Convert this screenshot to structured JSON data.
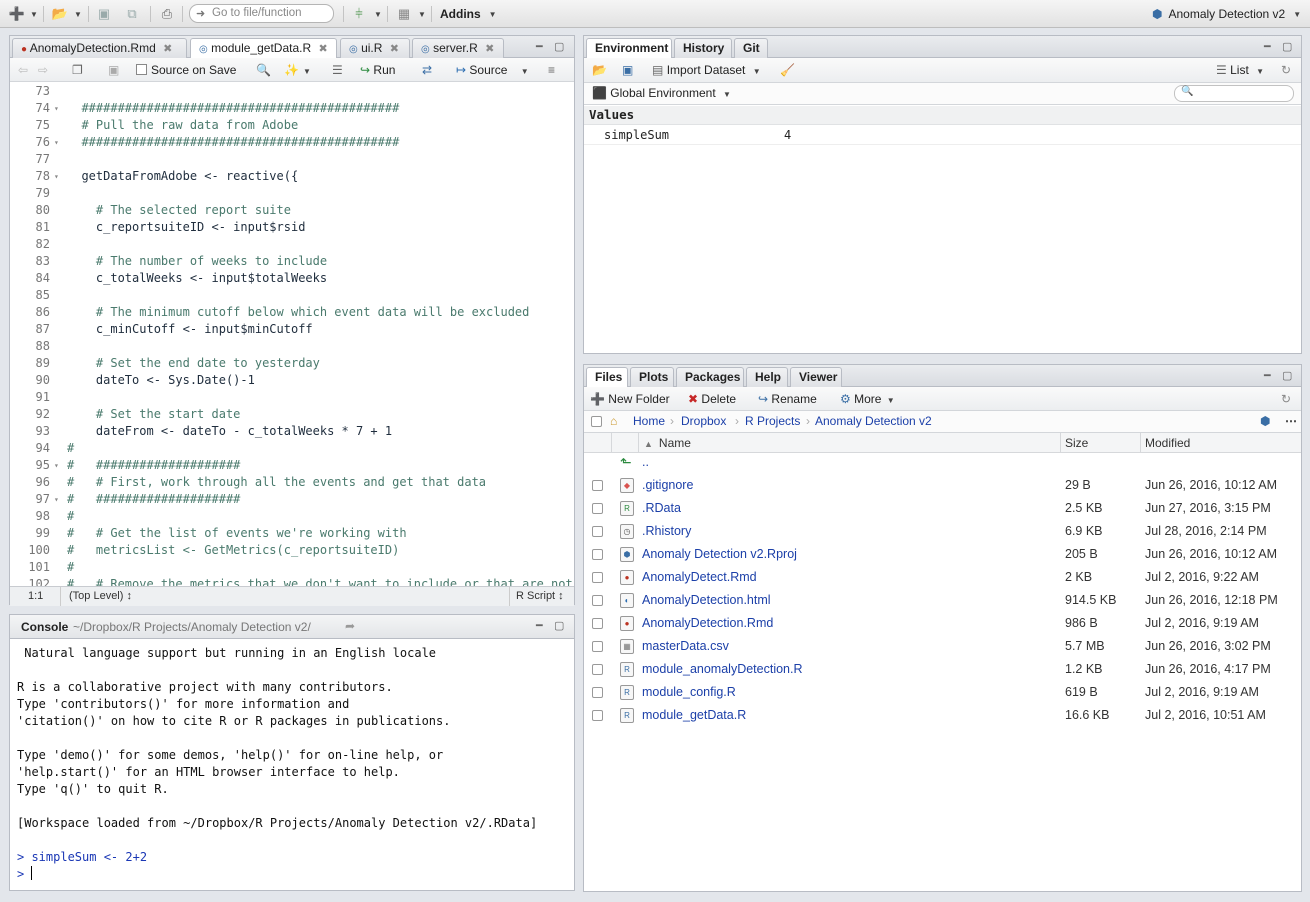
{
  "main_toolbar": {
    "goto_placeholder": "Go to file/function",
    "addins_label": "Addins",
    "project_label": "Anomaly Detection v2"
  },
  "source_pane": {
    "tabs": [
      {
        "label": "AnomalyDetection.Rmd"
      },
      {
        "label": "module_getData.R"
      },
      {
        "label": "ui.R"
      },
      {
        "label": "server.R"
      }
    ],
    "toolbar": {
      "source_on_save": "Source on Save",
      "run": "Run",
      "source": "Source"
    },
    "lines": [
      {
        "n": "73",
        "fold": false,
        "text": ""
      },
      {
        "n": "74",
        "fold": true,
        "text": "  ############################################"
      },
      {
        "n": "75",
        "fold": false,
        "text": "  # Pull the raw data from Adobe"
      },
      {
        "n": "76",
        "fold": true,
        "text": "  ############################################"
      },
      {
        "n": "77",
        "fold": false,
        "text": ""
      },
      {
        "n": "78",
        "fold": true,
        "text": "  getDataFromAdobe <- reactive({"
      },
      {
        "n": "79",
        "fold": false,
        "text": ""
      },
      {
        "n": "80",
        "fold": false,
        "text": "    # The selected report suite"
      },
      {
        "n": "81",
        "fold": false,
        "text": "    c_reportsuiteID <- input$rsid"
      },
      {
        "n": "82",
        "fold": false,
        "text": ""
      },
      {
        "n": "83",
        "fold": false,
        "text": "    # The number of weeks to include"
      },
      {
        "n": "84",
        "fold": false,
        "text": "    c_totalWeeks <- input$totalWeeks"
      },
      {
        "n": "85",
        "fold": false,
        "text": ""
      },
      {
        "n": "86",
        "fold": false,
        "text": "    # The minimum cutoff below which event data will be excluded"
      },
      {
        "n": "87",
        "fold": false,
        "text": "    c_minCutoff <- input$minCutoff"
      },
      {
        "n": "88",
        "fold": false,
        "text": ""
      },
      {
        "n": "89",
        "fold": false,
        "text": "    # Set the end date to yesterday"
      },
      {
        "n": "90",
        "fold": false,
        "text": "    dateTo <- Sys.Date()-1"
      },
      {
        "n": "91",
        "fold": false,
        "text": ""
      },
      {
        "n": "92",
        "fold": false,
        "text": "    # Set the start date"
      },
      {
        "n": "93",
        "fold": false,
        "text": "    dateFrom <- dateTo - c_totalWeeks * 7 + 1"
      },
      {
        "n": "94",
        "fold": false,
        "text": "#"
      },
      {
        "n": "95",
        "fold": true,
        "text": "#   ####################"
      },
      {
        "n": "96",
        "fold": false,
        "text": "#   # First, work through all the events and get that data"
      },
      {
        "n": "97",
        "fold": true,
        "text": "#   ####################"
      },
      {
        "n": "98",
        "fold": false,
        "text": "#"
      },
      {
        "n": "99",
        "fold": false,
        "text": "#   # Get the list of events we're working with"
      },
      {
        "n": "100",
        "fold": false,
        "text": "#   metricsList <- GetMetrics(c_reportsuiteID)"
      },
      {
        "n": "101",
        "fold": false,
        "text": "#"
      },
      {
        "n": "102",
        "fold": false,
        "text": "#   # Remove the metrics that we don't want to include or that are not"
      }
    ],
    "status": {
      "position": "1:1",
      "scope": "(Top Level) ↕",
      "filetype": "R Script ↕"
    }
  },
  "console_pane": {
    "title": "Console",
    "path": "~/Dropbox/R Projects/Anomaly Detection v2/",
    "lines": [
      {
        "text": " Natural language support but running in an English locale",
        "prompt": false
      },
      {
        "text": "",
        "prompt": false
      },
      {
        "text": "R is a collaborative project with many contributors.",
        "prompt": false
      },
      {
        "text": "Type 'contributors()' for more information and",
        "prompt": false
      },
      {
        "text": "'citation()' on how to cite R or R packages in publications.",
        "prompt": false
      },
      {
        "text": "",
        "prompt": false
      },
      {
        "text": "Type 'demo()' for some demos, 'help()' for on-line help, or",
        "prompt": false
      },
      {
        "text": "'help.start()' for an HTML browser interface to help.",
        "prompt": false
      },
      {
        "text": "Type 'q()' to quit R.",
        "prompt": false
      },
      {
        "text": "",
        "prompt": false
      },
      {
        "text": "[Workspace loaded from ~/Dropbox/R Projects/Anomaly Detection v2/.RData]",
        "prompt": false
      },
      {
        "text": "",
        "prompt": false
      },
      {
        "text": "> simpleSum <- 2+2",
        "prompt": true
      },
      {
        "text": "> ",
        "prompt": true
      }
    ]
  },
  "env_pane": {
    "tabs": [
      {
        "label": "Environment"
      },
      {
        "label": "History"
      },
      {
        "label": "Git"
      }
    ],
    "import_dataset": "Import Dataset",
    "list_label": "List",
    "global_env": "Global Environment",
    "values_header": "Values",
    "values": [
      {
        "name": "simpleSum",
        "value": "4"
      }
    ]
  },
  "files_pane": {
    "tabs": [
      {
        "label": "Files"
      },
      {
        "label": "Plots"
      },
      {
        "label": "Packages"
      },
      {
        "label": "Help"
      },
      {
        "label": "Viewer"
      }
    ],
    "new_folder": "New Folder",
    "delete": "Delete",
    "rename": "Rename",
    "more": "More",
    "breadcrumb": [
      "Home",
      "Dropbox",
      "R Projects",
      "Anomaly Detection v2"
    ],
    "columns": {
      "name": "Name",
      "size": "Size",
      "modified": "Modified"
    },
    "parent": "..",
    "files": [
      {
        "name": ".gitignore",
        "size": "29 B",
        "modified": "Jun 26, 2016, 10:12 AM",
        "icon": "gitignore-icon"
      },
      {
        "name": ".RData",
        "size": "2.5 KB",
        "modified": "Jun 27, 2016, 3:15 PM",
        "icon": "rdata-icon"
      },
      {
        "name": ".Rhistory",
        "size": "6.9 KB",
        "modified": "Jul 28, 2016, 2:14 PM",
        "icon": "rhistory-icon"
      },
      {
        "name": "Anomaly Detection v2.Rproj",
        "size": "205 B",
        "modified": "Jun 26, 2016, 10:12 AM",
        "icon": "rproj-icon"
      },
      {
        "name": "AnomalyDetect.Rmd",
        "size": "2 KB",
        "modified": "Jul 2, 2016, 9:22 AM",
        "icon": "rmd-icon"
      },
      {
        "name": "AnomalyDetection.html",
        "size": "914.5 KB",
        "modified": "Jun 26, 2016, 12:18 PM",
        "icon": "html-icon"
      },
      {
        "name": "AnomalyDetection.Rmd",
        "size": "986 B",
        "modified": "Jul 2, 2016, 9:19 AM",
        "icon": "rmd-icon"
      },
      {
        "name": "masterData.csv",
        "size": "5.7 MB",
        "modified": "Jun 26, 2016, 3:02 PM",
        "icon": "csv-icon"
      },
      {
        "name": "module_anomalyDetection.R",
        "size": "1.2 KB",
        "modified": "Jun 26, 2016, 4:17 PM",
        "icon": "r-file-icon"
      },
      {
        "name": "module_config.R",
        "size": "619 B",
        "modified": "Jul 2, 2016, 9:19 AM",
        "icon": "r-file-icon"
      },
      {
        "name": "module_getData.R",
        "size": "16.6 KB",
        "modified": "Jul 2, 2016, 10:51 AM",
        "icon": "r-file-icon"
      }
    ]
  }
}
